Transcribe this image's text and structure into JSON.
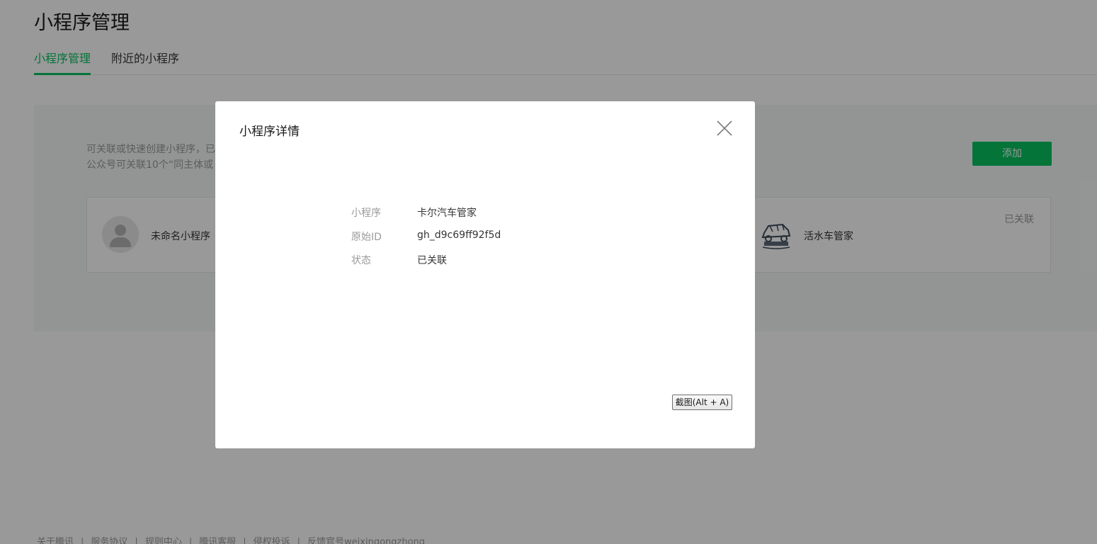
{
  "page": {
    "title": "小程序管理",
    "tabs": [
      {
        "label": "小程序管理",
        "active": true
      },
      {
        "label": "附近的小程序",
        "active": false
      }
    ]
  },
  "panel": {
    "notice_line1": "可关联或快速创建小程序，已",
    "notice_line2": "公众号可关联10个“同主体或",
    "add_label": "添加",
    "card": {
      "mp1_name": "未命名小程序",
      "mp2_name": "活水车管家",
      "mp2_status": "已关联"
    }
  },
  "dialog": {
    "title": "小程序详情",
    "rows": [
      {
        "label": "小程序",
        "value": "卡尔汽车管家"
      },
      {
        "label": "原始ID",
        "value": "gh_d9c69ff92f5d"
      },
      {
        "label": "状态",
        "value": "已关联"
      }
    ],
    "screenshot_button": "截图(Alt + A)"
  },
  "footer": {
    "links": [
      "关于腾讯",
      "服务协议",
      "规则中心",
      "腾讯客服",
      "侵权投诉",
      "反馈官号weixingongzhong"
    ]
  },
  "colors": {
    "accent": "#07c160",
    "mask": "rgba(0,0,0,0.40)"
  }
}
